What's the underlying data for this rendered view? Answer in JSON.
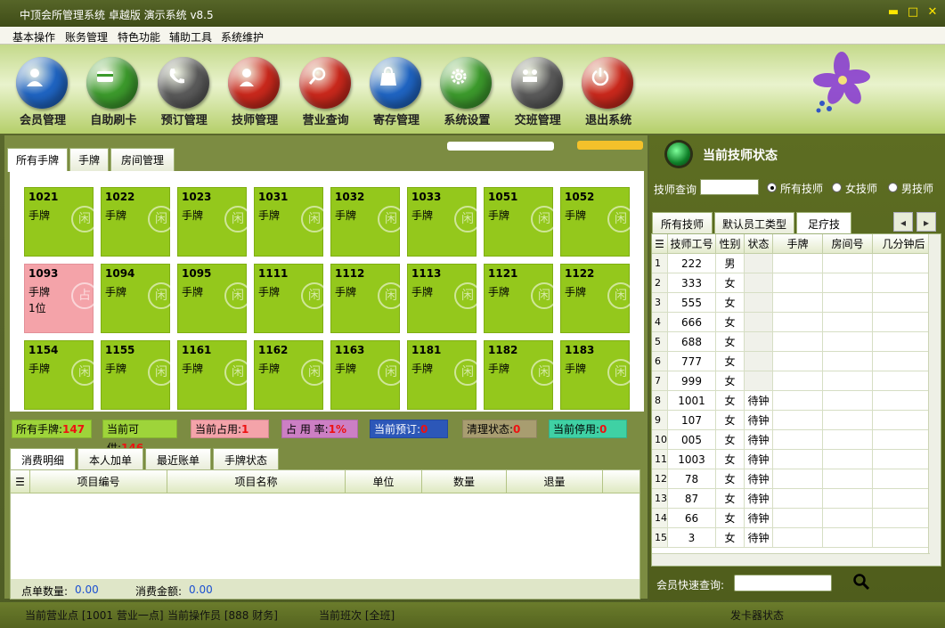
{
  "window": {
    "title": "中顶会所管理系统 卓越版 演示系统 v8.5",
    "min": "▬",
    "max": "□",
    "close": "✕"
  },
  "menu": [
    "基本操作",
    "账务管理",
    "特色功能",
    "辅助工具",
    "系统维护"
  ],
  "toolbar": [
    {
      "label": "会员管理",
      "color": "#1f64c2",
      "icon": "member-icon"
    },
    {
      "label": "自助刷卡",
      "color": "#3c9a2c",
      "icon": "card-icon"
    },
    {
      "label": "预订管理",
      "color": "#5a5a5a",
      "icon": "phone-icon"
    },
    {
      "label": "技师管理",
      "color": "#c9281c",
      "icon": "technician-icon"
    },
    {
      "label": "营业查询",
      "color": "#c9281c",
      "icon": "search-icon"
    },
    {
      "label": "寄存管理",
      "color": "#1f64c2",
      "icon": "bag-icon"
    },
    {
      "label": "系统设置",
      "color": "#3c9a2c",
      "icon": "gear-icon"
    },
    {
      "label": "交班管理",
      "color": "#5a5a5a",
      "icon": "handover-icon"
    },
    {
      "label": "退出系统",
      "color": "#c9281c",
      "icon": "power-icon"
    }
  ],
  "left_tabs": [
    "所有手牌",
    "手牌",
    "房间管理"
  ],
  "cards": [
    [
      {
        "num": "1021",
        "sub": "手牌"
      },
      {
        "num": "1022",
        "sub": "手牌"
      },
      {
        "num": "1023",
        "sub": "手牌"
      },
      {
        "num": "1031",
        "sub": "手牌"
      },
      {
        "num": "1032",
        "sub": "手牌"
      },
      {
        "num": "1033",
        "sub": "手牌"
      },
      {
        "num": "1051",
        "sub": "手牌"
      },
      {
        "num": "1052",
        "sub": "手牌"
      }
    ],
    [
      {
        "num": "1093",
        "sub": "手牌",
        "sub2": "1位",
        "occupied": true
      },
      {
        "num": "1094",
        "sub": "手牌"
      },
      {
        "num": "1095",
        "sub": "手牌"
      },
      {
        "num": "1111",
        "sub": "手牌"
      },
      {
        "num": "1112",
        "sub": "手牌"
      },
      {
        "num": "1113",
        "sub": "手牌"
      },
      {
        "num": "1121",
        "sub": "手牌"
      },
      {
        "num": "1122",
        "sub": "手牌"
      }
    ],
    [
      {
        "num": "1154",
        "sub": "手牌"
      },
      {
        "num": "1155",
        "sub": "手牌"
      },
      {
        "num": "1161",
        "sub": "手牌"
      },
      {
        "num": "1162",
        "sub": "手牌"
      },
      {
        "num": "1163",
        "sub": "手牌"
      },
      {
        "num": "1181",
        "sub": "手牌"
      },
      {
        "num": "1182",
        "sub": "手牌"
      },
      {
        "num": "1183",
        "sub": "手牌"
      }
    ]
  ],
  "card_watermark": {
    "free": "闲",
    "occupied": "占"
  },
  "stats": [
    {
      "label": "所有手牌:",
      "value": "147",
      "bg": "#9ed43a"
    },
    {
      "label": "当前可供:",
      "value": "146",
      "bg": "#9ed43a"
    },
    {
      "label": "当前占用:",
      "value": "1",
      "bg": "#f4a3a9"
    },
    {
      "label": "占 用 率:",
      "value": "1%",
      "bg": "#cc7fc4"
    },
    {
      "label": "当前预订:",
      "value": "0",
      "bg": "#2c57b8"
    },
    {
      "label": "清理状态:",
      "value": "0",
      "bg": "#a89d70"
    },
    {
      "label": "当前停用:",
      "value": "0",
      "bg": "#3fd1a4"
    }
  ],
  "bottom_tabs": [
    "消费明细",
    "本人加单",
    "最近账单",
    "手牌状态"
  ],
  "consume_columns": [
    "项目编号",
    "项目名称",
    "单位",
    "数量",
    "退量"
  ],
  "consume_footer": {
    "count_label": "点单数量:",
    "count": "0.00",
    "amount_label": "消费金额:",
    "amount": "0.00"
  },
  "status": {
    "point": "当前营业点 [1001 营业一点]",
    "operator": "当前操作员 [888 财务]",
    "shift": "当前班次 [全班]",
    "card_reader": "发卡器状态"
  },
  "right": {
    "title": "当前技师状态",
    "query_label": "技师查询",
    "radios": [
      {
        "label": "所有技师",
        "on": true
      },
      {
        "label": "女技师",
        "on": false
      },
      {
        "label": "男技师",
        "on": false
      }
    ],
    "tabs": [
      "所有技师",
      "默认员工类型",
      "足疗技师"
    ],
    "columns": [
      "技师工号",
      "性别",
      "状态",
      "手牌",
      "房间号",
      "几分钟后"
    ],
    "rows": [
      {
        "n": "1",
        "id": "222",
        "sex": "男",
        "st": ""
      },
      {
        "n": "2",
        "id": "333",
        "sex": "女",
        "st": ""
      },
      {
        "n": "3",
        "id": "555",
        "sex": "女",
        "st": ""
      },
      {
        "n": "4",
        "id": "666",
        "sex": "女",
        "st": ""
      },
      {
        "n": "5",
        "id": "688",
        "sex": "女",
        "st": ""
      },
      {
        "n": "6",
        "id": "777",
        "sex": "女",
        "st": ""
      },
      {
        "n": "7",
        "id": "999",
        "sex": "女",
        "st": ""
      },
      {
        "n": "8",
        "id": "1001",
        "sex": "女",
        "st": "待钟"
      },
      {
        "n": "9",
        "id": "107",
        "sex": "女",
        "st": "待钟"
      },
      {
        "n": "10",
        "id": "005",
        "sex": "女",
        "st": "待钟"
      },
      {
        "n": "11",
        "id": "1003",
        "sex": "女",
        "st": "待钟"
      },
      {
        "n": "12",
        "id": "78",
        "sex": "女",
        "st": "待钟"
      },
      {
        "n": "13",
        "id": "87",
        "sex": "女",
        "st": "待钟"
      },
      {
        "n": "14",
        "id": "66",
        "sex": "女",
        "st": "待钟"
      },
      {
        "n": "15",
        "id": "3",
        "sex": "女",
        "st": "待钟"
      }
    ],
    "quick_label": "会员快速查询:"
  }
}
